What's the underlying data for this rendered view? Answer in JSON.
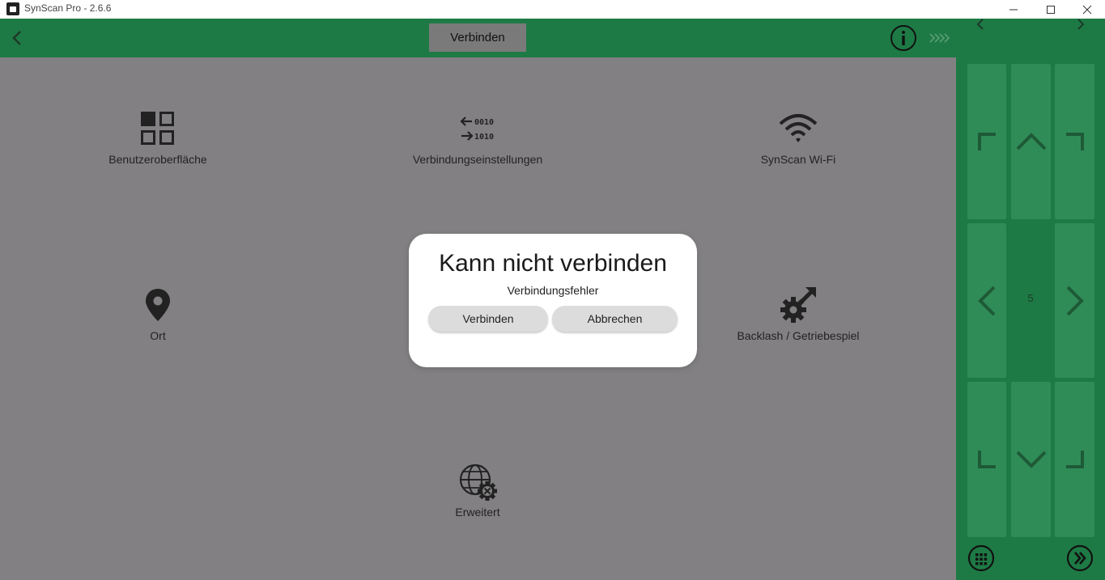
{
  "window": {
    "title": "SynScan Pro - 2.6.6"
  },
  "header": {
    "active_tab": "Verbinden"
  },
  "tiles": [
    {
      "label": "Benutzeroberfläche",
      "icon": "grid-icon"
    },
    {
      "label": "Verbindungseinstellungen",
      "icon": "data-transfer-icon"
    },
    {
      "label": "SynScan Wi-Fi",
      "icon": "wifi-icon"
    },
    {
      "label": "Ort",
      "icon": "location-pin-icon"
    },
    {
      "label": "Backlash / Getriebespiel",
      "icon": "gear-arrow-icon"
    },
    {
      "label": "Erweitert",
      "icon": "globe-gear-icon"
    }
  ],
  "hand_control": {
    "speed": "5"
  },
  "dialog": {
    "title": "Kann nicht verbinden",
    "message": "Verbindungsfehler",
    "connect_label": "Verbinden",
    "cancel_label": "Abbrechen"
  },
  "colors": {
    "header_green": "#1e7a45",
    "pad_button_green": "#2f8c57",
    "overlay_grey": "#828083",
    "active_tab_grey": "#7a7a7a"
  }
}
